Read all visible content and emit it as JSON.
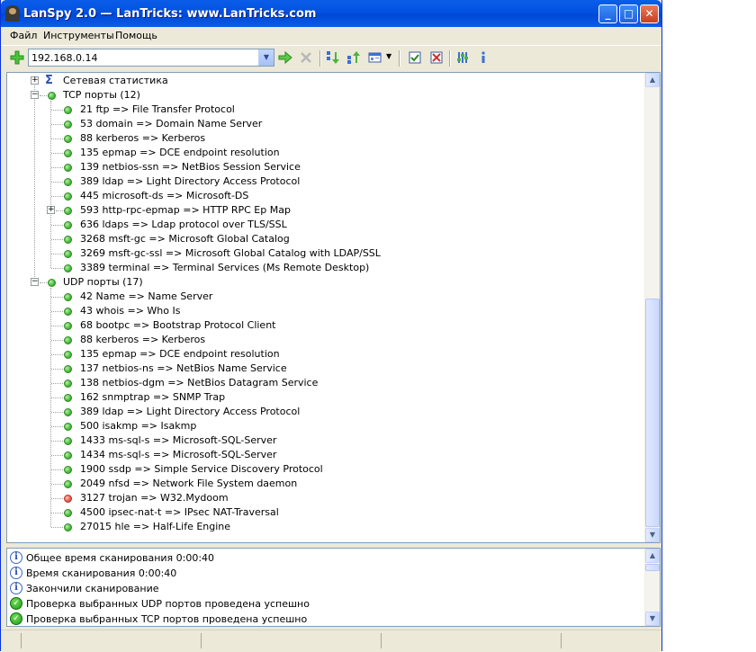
{
  "window": {
    "title": "LanSpy 2.0 — LanTricks: www.LanTricks.com",
    "buttons": {
      "minimize": "_",
      "maximize": "□",
      "close": "✕"
    }
  },
  "menu": [
    "Файл",
    "Инструменты",
    "Помощь"
  ],
  "toolbar": {
    "address": "192.168.0.14",
    "icons": [
      "add-icon",
      "go-arrow-icon",
      "stop-icon",
      "import-icon",
      "export-icon",
      "view-options-icon",
      "check-all-icon",
      "uncheck-all-icon",
      "settings-icon",
      "info-icon"
    ]
  },
  "tree": {
    "network_stats": "Сетевая статистика",
    "tcp": {
      "label": "TCP порты (12)",
      "items": [
        {
          "text": "21 ftp => File Transfer Protocol",
          "status": "ok"
        },
        {
          "text": "53 domain => Domain Name Server",
          "status": "ok"
        },
        {
          "text": "88 kerberos => Kerberos",
          "status": "ok"
        },
        {
          "text": "135 epmap => DCE endpoint resolution",
          "status": "ok"
        },
        {
          "text": "139 netbios-ssn => NetBios Session Service",
          "status": "ok"
        },
        {
          "text": "389 ldap => Light Directory Access Protocol",
          "status": "ok"
        },
        {
          "text": "445 microsoft-ds => Microsoft-DS",
          "status": "ok"
        },
        {
          "text": "593 http-rpc-epmap => HTTP RPC Ep Map",
          "status": "ok",
          "expandable": true
        },
        {
          "text": "636 ldaps => Ldap protocol over TLS/SSL",
          "status": "ok"
        },
        {
          "text": "3268 msft-gc => Microsoft Global Catalog",
          "status": "ok"
        },
        {
          "text": "3269 msft-gc-ssl => Microsoft Global Catalog with LDAP/SSL",
          "status": "ok"
        },
        {
          "text": "3389 terminal => Terminal Services (Ms Remote Desktop)",
          "status": "ok"
        }
      ]
    },
    "udp": {
      "label": "UDP порты (17)",
      "items": [
        {
          "text": "42 Name => Name Server",
          "status": "ok"
        },
        {
          "text": "43 whois => Who Is",
          "status": "ok"
        },
        {
          "text": "68 bootpc => Bootstrap Protocol Client",
          "status": "ok"
        },
        {
          "text": "88 kerberos => Kerberos",
          "status": "ok"
        },
        {
          "text": "135 epmap => DCE endpoint resolution",
          "status": "ok"
        },
        {
          "text": "137 netbios-ns => NetBios Name Service",
          "status": "ok"
        },
        {
          "text": "138 netbios-dgm => NetBios Datagram Service",
          "status": "ok"
        },
        {
          "text": "162 snmptrap => SNMP Trap",
          "status": "ok"
        },
        {
          "text": "389 ldap => Light Directory Access Protocol",
          "status": "ok"
        },
        {
          "text": "500 isakmp => Isakmp",
          "status": "ok"
        },
        {
          "text": "1433 ms-sql-s => Microsoft-SQL-Server",
          "status": "ok"
        },
        {
          "text": "1434 ms-sql-s => Microsoft-SQL-Server",
          "status": "ok"
        },
        {
          "text": "1900 ssdp => Simple Service Discovery Protocol",
          "status": "ok"
        },
        {
          "text": "2049 nfsd => Network File System daemon",
          "status": "ok"
        },
        {
          "text": "3127 trojan => W32.Mydoom",
          "status": "alert"
        },
        {
          "text": "4500 ipsec-nat-t => IPsec NAT-Traversal",
          "status": "ok"
        },
        {
          "text": "27015 hle => Half-Life Engine",
          "status": "ok"
        }
      ]
    }
  },
  "log": [
    {
      "icon": "info-icon",
      "text": "Общее время сканирования 0:00:40"
    },
    {
      "icon": "info-icon",
      "text": "Время сканирования 0:00:40"
    },
    {
      "icon": "info-icon",
      "text": "Закончили сканирование"
    },
    {
      "icon": "check-icon",
      "text": "Проверка выбранных UDP портов проведена успешно"
    },
    {
      "icon": "check-icon",
      "text": "Проверка выбранных TCP портов проведена успешно"
    }
  ],
  "colors": {
    "titlebar": "#0a5ee8",
    "ok": "#38b02a",
    "alert": "#e04a3a"
  }
}
